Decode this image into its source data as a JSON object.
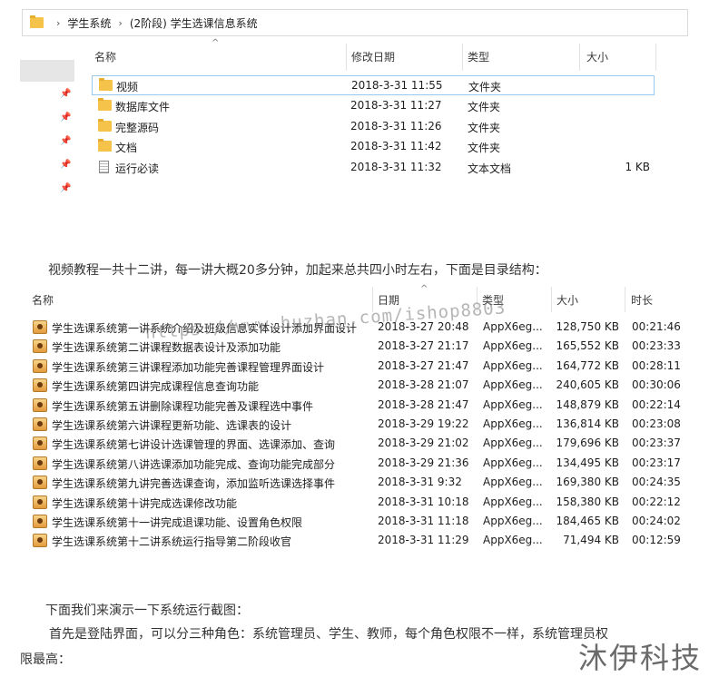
{
  "explorer": {
    "breadcrumb": [
      "学生系统",
      "(2阶段) 学生选课信息系统"
    ],
    "columns": {
      "name": "名称",
      "date": "修改日期",
      "type": "类型",
      "size": "大小"
    },
    "files": [
      {
        "name": "视频",
        "date": "2018-3-31 11:55",
        "type": "文件夹",
        "size": "",
        "icon": "folder-icon"
      },
      {
        "name": "数据库文件",
        "date": "2018-3-31 11:27",
        "type": "文件夹",
        "size": "",
        "icon": "folder-icon"
      },
      {
        "name": "完整源码",
        "date": "2018-3-31 11:26",
        "type": "文件夹",
        "size": "",
        "icon": "folder-icon"
      },
      {
        "name": "文档",
        "date": "2018-3-31 11:42",
        "type": "文件夹",
        "size": "",
        "icon": "folder-icon"
      },
      {
        "name": "运行必读",
        "date": "2018-3-31 11:32",
        "type": "文本文档",
        "size": "1 KB",
        "icon": "text-file-icon"
      }
    ]
  },
  "intro_text": "视频教程一共十二讲，每一讲大概20多分钟，加起来总共四小时左右，下面是目录结构：",
  "videos": {
    "columns": {
      "name": "名称",
      "date": "日期",
      "type": "类型",
      "size": "大小",
      "duration": "时长"
    },
    "rows": [
      {
        "name": "学生选课系统第一讲系统介绍及班级信息实体设计添加界面设计",
        "date": "2018-3-27 20:48",
        "type": "AppX6eg...",
        "size": "128,750 KB",
        "duration": "00:21:46"
      },
      {
        "name": "学生选课系统第二讲课程数据表设计及添加功能",
        "date": "2018-3-27 21:17",
        "type": "AppX6eg...",
        "size": "165,552 KB",
        "duration": "00:23:33"
      },
      {
        "name": "学生选课系统第三讲课程添加功能完善课程管理界面设计",
        "date": "2018-3-27 21:47",
        "type": "AppX6eg...",
        "size": "164,772 KB",
        "duration": "00:28:11"
      },
      {
        "name": "学生选课系统第四讲完成课程信息查询功能",
        "date": "2018-3-28 21:07",
        "type": "AppX6eg...",
        "size": "240,605 KB",
        "duration": "00:30:06"
      },
      {
        "name": "学生选课系统第五讲删除课程功能完善及课程选中事件",
        "date": "2018-3-28 21:47",
        "type": "AppX6eg...",
        "size": "148,879 KB",
        "duration": "00:22:14"
      },
      {
        "name": "学生选课系统第六讲课程更新功能、选课表的设计",
        "date": "2018-3-29 19:22",
        "type": "AppX6eg...",
        "size": "136,814 KB",
        "duration": "00:23:08"
      },
      {
        "name": "学生选课系统第七讲设计选课管理的界面、选课添加、查询",
        "date": "2018-3-29 21:02",
        "type": "AppX6eg...",
        "size": "179,696 KB",
        "duration": "00:23:37"
      },
      {
        "name": "学生选课系统第八讲选课添加功能完成、查询功能完成部分",
        "date": "2018-3-29 21:36",
        "type": "AppX6eg...",
        "size": "134,495 KB",
        "duration": "00:23:17"
      },
      {
        "name": "学生选课系统第九讲完善选课查询，添加监听选课选择事件",
        "date": "2018-3-31 9:32",
        "type": "AppX6eg...",
        "size": "169,380 KB",
        "duration": "00:24:35"
      },
      {
        "name": "学生选课系统第十讲完成选课修改功能",
        "date": "2018-3-31 10:18",
        "type": "AppX6eg...",
        "size": "158,380 KB",
        "duration": "00:22:12"
      },
      {
        "name": "学生选课系统第十一讲完成退课功能、设置角色权限",
        "date": "2018-3-31 11:18",
        "type": "AppX6eg...",
        "size": "184,465 KB",
        "duration": "00:24:02"
      },
      {
        "name": "学生选课系统第十二讲系统运行指导第二阶段收官",
        "date": "2018-3-31 11:29",
        "type": "AppX6eg...",
        "size": "71,494 KB",
        "duration": "00:12:59"
      }
    ]
  },
  "demo_text": "下面我们来演示一下系统运行截图：",
  "login_text_1": "首先是登陆界面，可以分三种角色：系统管理员、学生、教师，每个角色权限不一样，系统管理员权",
  "login_text_2": "限最高：",
  "watermark": "https://www.huzhan.com/ishop8803",
  "brand": "沐伊科技"
}
